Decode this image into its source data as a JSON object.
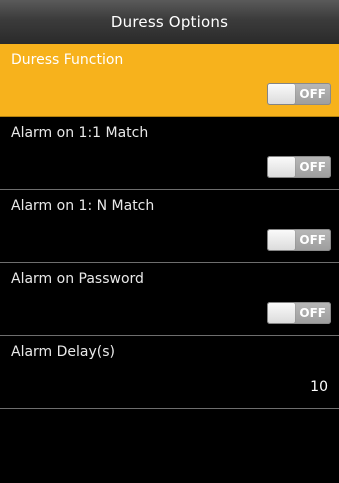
{
  "header": {
    "title": "Duress Options"
  },
  "menu": {
    "items": [
      {
        "label": "Duress Function",
        "control": "toggle",
        "state": "OFF",
        "selected": true
      },
      {
        "label": "Alarm on 1:1 Match",
        "control": "toggle",
        "state": "OFF",
        "selected": false
      },
      {
        "label": "Alarm on 1: N Match",
        "control": "toggle",
        "state": "OFF",
        "selected": false
      },
      {
        "label": "Alarm on Password",
        "control": "toggle",
        "state": "OFF",
        "selected": false
      },
      {
        "label": "Alarm Delay(s)",
        "control": "value",
        "value": "10",
        "selected": false
      }
    ]
  },
  "colors": {
    "highlight": "#f7b21c",
    "background": "#000000",
    "toggle_off": "#a8a8a8"
  }
}
